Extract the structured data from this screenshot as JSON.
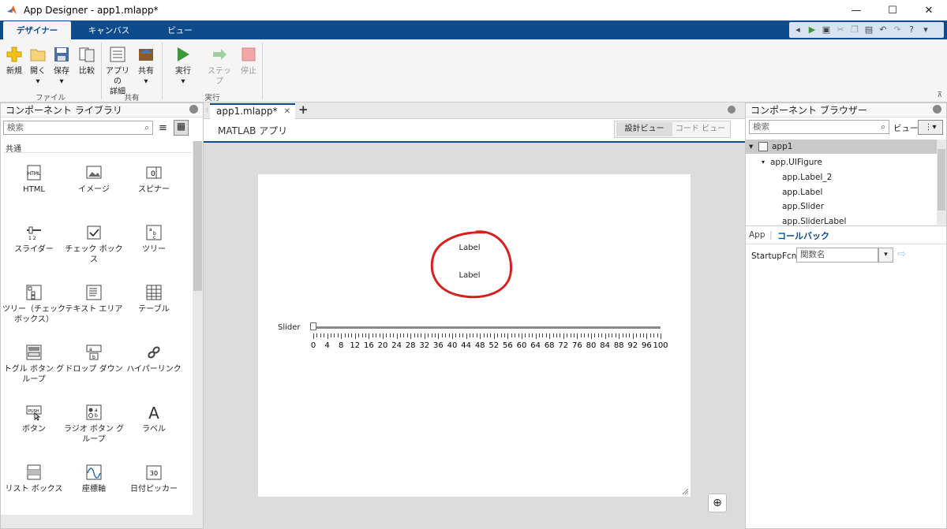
{
  "window": {
    "title": "App Designer - app1.mlapp*",
    "min": "—",
    "max": "☐",
    "close": "✕"
  },
  "ribbon_tabs": [
    {
      "label": "デザイナー"
    },
    {
      "label": "キャンバス"
    },
    {
      "label": "ビュー"
    }
  ],
  "ribbon": {
    "file": {
      "new": "新規",
      "open": "開く",
      "save": "保存",
      "compare": "比較",
      "group": "ファイル"
    },
    "share": {
      "details_line1": "アプリの",
      "details_line2": "詳細",
      "share": "共有",
      "group": "共有"
    },
    "run": {
      "run": "実行",
      "step": "ステップ",
      "stop": "停止",
      "group": "実行"
    }
  },
  "library": {
    "title": "コンポーネント ライブラリ",
    "search_placeholder": "検索",
    "section": "共通",
    "items": [
      {
        "label": "HTML",
        "icon": "html-icon"
      },
      {
        "label": "イメージ",
        "icon": "image-icon"
      },
      {
        "label": "スピナー",
        "icon": "spinner-icon"
      },
      {
        "label": "スライダー",
        "icon": "slider-icon"
      },
      {
        "label": "チェック ボックス",
        "icon": "checkbox-icon"
      },
      {
        "label": "ツリー",
        "icon": "tree-icon"
      },
      {
        "label": "ツリー（チェック",
        "label2": "ボックス）",
        "icon": "tree-checkbox-icon"
      },
      {
        "label": "テキスト エリア",
        "icon": "text-area-icon"
      },
      {
        "label": "テーブル",
        "icon": "table-icon"
      },
      {
        "label": "トグル ボタン グ",
        "label2": "ループ",
        "icon": "toggle-button-group-icon"
      },
      {
        "label": "ドロップ ダウン",
        "icon": "dropdown-icon"
      },
      {
        "label": "ハイパーリンク",
        "icon": "hyperlink-icon"
      },
      {
        "label": "ボタン",
        "icon": "push-button-icon"
      },
      {
        "label": "ラジオ ボタン グ",
        "label2": "ループ",
        "icon": "radio-button-group-icon"
      },
      {
        "label": "ラベル",
        "icon": "label-icon"
      },
      {
        "label": "リスト ボックス",
        "icon": "list-box-icon"
      },
      {
        "label": "座標軸",
        "icon": "axes-icon"
      },
      {
        "label": "日付ピッカー",
        "icon": "date-picker-icon"
      }
    ]
  },
  "editor": {
    "tab": "app1.mlapp*",
    "header": "MATLAB アプリ",
    "design_view": "設計ビュー",
    "code_view": "コード ビュー"
  },
  "canvas": {
    "label1": "Label",
    "label2": "Label",
    "slider_label": "Slider",
    "slider_value": 0,
    "slider_ticks": [
      "0",
      "4",
      "8",
      "12",
      "16",
      "20",
      "24",
      "28",
      "32",
      "36",
      "40",
      "44",
      "48",
      "52",
      "56",
      "60",
      "64",
      "68",
      "72",
      "76",
      "80",
      "84",
      "88",
      "92",
      "96",
      "100"
    ]
  },
  "browser": {
    "title": "コンポーネント ブラウザー",
    "search_placeholder": "検索",
    "view_label": "ビュー:",
    "tree": [
      "app1",
      "app.UIFigure",
      "app.Label_2",
      "app.Label",
      "app.Slider",
      "app.SliderLabel"
    ],
    "tab_app": "App",
    "tab_callback": "コールバック",
    "startup_label": "StartupFcn",
    "startup_value": "関数名"
  },
  "colors": {
    "accent": "#0e4b8c",
    "annotation": "#d62020",
    "run_green": "#3a9a3a"
  }
}
